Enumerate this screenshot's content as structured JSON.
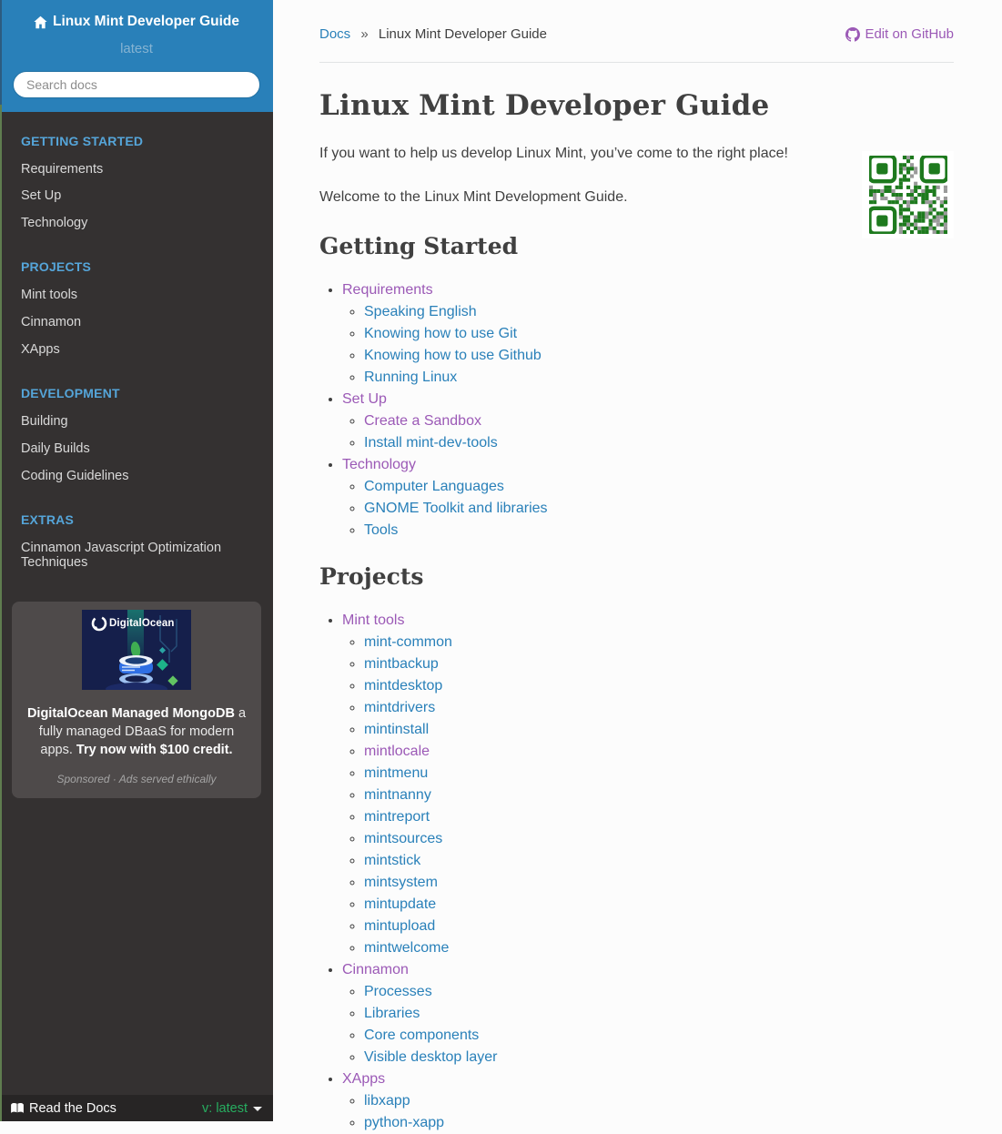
{
  "colors": {
    "header_blue": "#2980B9",
    "sidebar_bg": "#343131",
    "caption_blue": "#55a5d9",
    "link_blue": "#2980B9",
    "link_visited_purple": "#9B59B6",
    "version_green": "#27AE60",
    "qr_green": "#1e7a1e",
    "qr_gray": "#9a9a9a"
  },
  "sidebar": {
    "title": "Linux Mint Developer Guide",
    "version": "latest",
    "search_placeholder": "Search docs",
    "sections": [
      {
        "caption": "GETTING STARTED",
        "items": [
          "Requirements",
          "Set Up",
          "Technology"
        ]
      },
      {
        "caption": "PROJECTS",
        "items": [
          "Mint tools",
          "Cinnamon",
          "XApps"
        ]
      },
      {
        "caption": "DEVELOPMENT",
        "items": [
          "Building",
          "Daily Builds",
          "Coding Guidelines"
        ]
      },
      {
        "caption": "EXTRAS",
        "items": [
          "Cinnamon Javascript Optimization Techniques"
        ]
      }
    ],
    "ad": {
      "image_brand": "DigitalOcean",
      "headline_bold1": "DigitalOcean Managed MongoDB",
      "text_mid": " a fully managed DBaaS for modern apps. ",
      "headline_bold2": "Try now with $100 credit.",
      "sponsor_note": "Sponsored · Ads served ethically"
    },
    "footer": {
      "brand": "Read the Docs",
      "version_label": "v: latest"
    }
  },
  "main": {
    "breadcrumb": {
      "root": "Docs",
      "separator": "»",
      "current": "Linux Mint Developer Guide"
    },
    "edit_link": "Edit on GitHub",
    "title": "Linux Mint Developer Guide",
    "paragraphs": [
      "If you want to help us develop Linux Mint, you’ve come to the right place!",
      "Welcome to the Linux Mint Development Guide."
    ],
    "sections": [
      {
        "heading": "Getting Started",
        "items": [
          {
            "label": "Requirements",
            "visited": true,
            "children": [
              {
                "label": "Speaking English",
                "visited": false
              },
              {
                "label": "Knowing how to use Git",
                "visited": false
              },
              {
                "label": "Knowing how to use Github",
                "visited": false
              },
              {
                "label": "Running Linux",
                "visited": false
              }
            ]
          },
          {
            "label": "Set Up",
            "visited": true,
            "children": [
              {
                "label": "Create a Sandbox",
                "visited": true
              },
              {
                "label": "Install mint-dev-tools",
                "visited": false
              }
            ]
          },
          {
            "label": "Technology",
            "visited": true,
            "children": [
              {
                "label": "Computer Languages",
                "visited": false
              },
              {
                "label": "GNOME Toolkit and libraries",
                "visited": false
              },
              {
                "label": "Tools",
                "visited": false
              }
            ]
          }
        ]
      },
      {
        "heading": "Projects",
        "items": [
          {
            "label": "Mint tools",
            "visited": true,
            "children": [
              {
                "label": "mint-common",
                "visited": false
              },
              {
                "label": "mintbackup",
                "visited": false
              },
              {
                "label": "mintdesktop",
                "visited": false
              },
              {
                "label": "mintdrivers",
                "visited": false
              },
              {
                "label": "mintinstall",
                "visited": false
              },
              {
                "label": "mintlocale",
                "visited": true
              },
              {
                "label": "mintmenu",
                "visited": false
              },
              {
                "label": "mintnanny",
                "visited": false
              },
              {
                "label": "mintreport",
                "visited": false
              },
              {
                "label": "mintsources",
                "visited": false
              },
              {
                "label": "mintstick",
                "visited": false
              },
              {
                "label": "mintsystem",
                "visited": false
              },
              {
                "label": "mintupdate",
                "visited": false
              },
              {
                "label": "mintupload",
                "visited": false
              },
              {
                "label": "mintwelcome",
                "visited": false
              }
            ]
          },
          {
            "label": "Cinnamon",
            "visited": true,
            "children": [
              {
                "label": "Processes",
                "visited": false
              },
              {
                "label": "Libraries",
                "visited": false
              },
              {
                "label": "Core components",
                "visited": false
              },
              {
                "label": "Visible desktop layer",
                "visited": false
              }
            ]
          },
          {
            "label": "XApps",
            "visited": true,
            "children": [
              {
                "label": "libxapp",
                "visited": false
              },
              {
                "label": "python-xapp",
                "visited": false
              }
            ]
          }
        ]
      }
    ]
  }
}
